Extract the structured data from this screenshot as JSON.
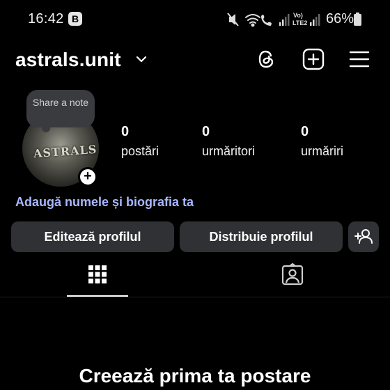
{
  "status_bar": {
    "time": "16:42",
    "badge": "B",
    "battery": "66%",
    "network_label_top": "Vo)",
    "network_label_bottom": "LTE2"
  },
  "header": {
    "username": "astrals.unit"
  },
  "profile": {
    "note_bubble": "Share a note",
    "avatar_text": "ASTRALS",
    "stats": [
      {
        "value": "0",
        "label": "postări"
      },
      {
        "value": "0",
        "label": "urmăritori"
      },
      {
        "value": "0",
        "label": "urmăriri"
      }
    ],
    "bio_prompt": "Adaugă numele și biografia ta"
  },
  "actions": {
    "edit_profile": "Editează profilul",
    "share_profile": "Distribuie profilul"
  },
  "tabs": {
    "active": "grid"
  },
  "empty_state": {
    "title": "Creează prima ta postare"
  },
  "colors": {
    "background": "#000000",
    "button_bg": "#2f3134",
    "link": "#a9b8ff"
  }
}
